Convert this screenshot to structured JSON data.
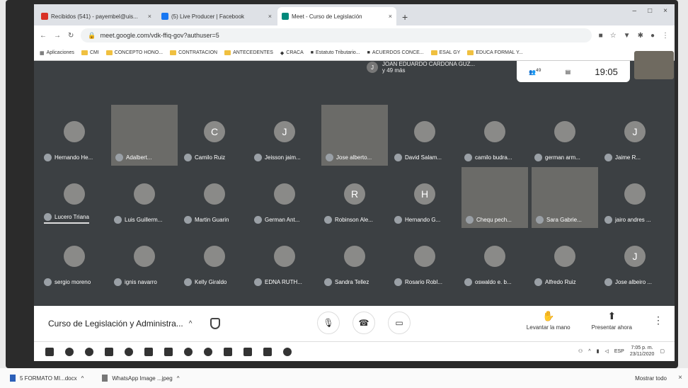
{
  "browser": {
    "tabs": [
      {
        "label": "Recibidos (541) - payembel@uis...",
        "color": "#d93025",
        "active": false
      },
      {
        "label": "(5) Live Producer | Facebook",
        "color": "#1877f2",
        "active": false
      },
      {
        "label": "Meet - Curso de Legislación",
        "color": "#00897b",
        "active": true
      }
    ],
    "new_tab": "+",
    "window_controls": [
      "–",
      "□",
      "×"
    ],
    "url": "meet.google.com/vdk-ffiq-gov?authuser=5",
    "bookmarks": [
      "Aplicaciones",
      "CMI",
      "CONCEPTO HONO...",
      "CONTRATACION",
      "ANTECEDENTES",
      "CRACA",
      "Estatuto Tributario...",
      "ACUERDOS CONCE...",
      "ESAL GY",
      "EDUCA FORMAL Y..."
    ]
  },
  "meet": {
    "presenter": {
      "initial": "J",
      "name": "JOAN EDUARDO CARDONA GUZ...",
      "sub": "y 49 más"
    },
    "info_card": {
      "participants": "49",
      "time": "19:05"
    },
    "participants": [
      {
        "name": "Hernando He...",
        "initial": "",
        "video": false
      },
      {
        "name": "Adalbert...",
        "initial": "",
        "video": true
      },
      {
        "name": "Camilo Ruiz",
        "initial": "C",
        "video": false
      },
      {
        "name": "Jeisson jaim...",
        "initial": "J",
        "video": false
      },
      {
        "name": "Jose alberto...",
        "initial": "",
        "video": true
      },
      {
        "name": "David Salam...",
        "initial": "",
        "video": false
      },
      {
        "name": "camilo budra...",
        "initial": "",
        "video": false
      },
      {
        "name": "german arm...",
        "initial": "",
        "video": false
      },
      {
        "name": "Jaime R...",
        "initial": "J",
        "video": false
      },
      {
        "name": "Lucero Triana",
        "initial": "",
        "video": false
      },
      {
        "name": "Luis Guillerm...",
        "initial": "",
        "video": false
      },
      {
        "name": "Martin Guarin",
        "initial": "",
        "video": false
      },
      {
        "name": "German Ant...",
        "initial": "",
        "video": false
      },
      {
        "name": "Robinson Ale...",
        "initial": "R",
        "video": false
      },
      {
        "name": "Hernando G...",
        "initial": "H",
        "video": false
      },
      {
        "name": "Chequ pech...",
        "initial": "",
        "video": true
      },
      {
        "name": "Sara Gabrie...",
        "initial": "",
        "video": true
      },
      {
        "name": "jairo andres ...",
        "initial": "",
        "video": false
      },
      {
        "name": "sergio moreno",
        "initial": "",
        "video": false
      },
      {
        "name": "ignis navarro",
        "initial": "",
        "video": false
      },
      {
        "name": "Kelly Giraldo",
        "initial": "",
        "video": false
      },
      {
        "name": "EDNA RUTH...",
        "initial": "",
        "video": false
      },
      {
        "name": "Sandra Tellez",
        "initial": "",
        "video": false
      },
      {
        "name": "Rosario Robl...",
        "initial": "",
        "video": false
      },
      {
        "name": "oswaldo e. b...",
        "initial": "",
        "video": false
      },
      {
        "name": "Alfredo Ruiz",
        "initial": "",
        "video": false
      },
      {
        "name": "Jose albeiro ...",
        "initial": "J",
        "video": false
      }
    ],
    "bottom": {
      "title": "Curso de Legislación y Administra...",
      "raise_hand": "Levantar la mano",
      "present": "Presentar ahora"
    }
  },
  "taskbar": {
    "clock_time": "7:05 p. m.",
    "clock_date": "23/11/2020",
    "lang": "ESP"
  },
  "downloads": {
    "items": [
      "5 FORMATO MI...docx",
      "WhatsApp Image ...jpeg"
    ],
    "show_all": "Mostrar todo"
  }
}
